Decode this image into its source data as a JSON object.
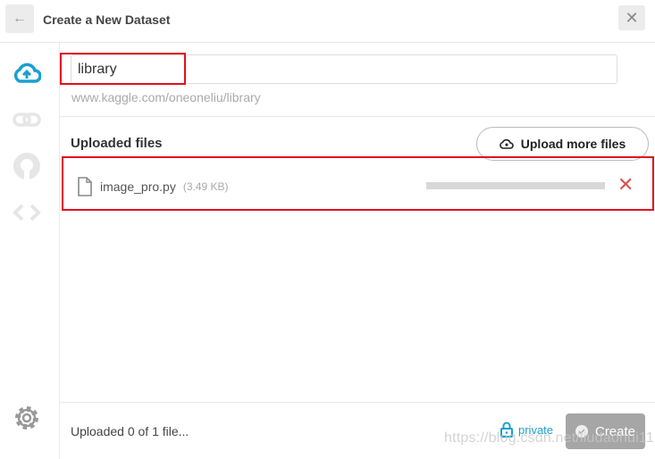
{
  "header": {
    "title": "Create a New Dataset",
    "back_icon": "arrow-left-icon",
    "close_icon": "close-icon"
  },
  "sidebar": {
    "items": [
      {
        "icon": "cloud-upload-icon",
        "active": true
      },
      {
        "icon": "link-icon"
      },
      {
        "icon": "github-icon"
      },
      {
        "icon": "code-icon"
      },
      {
        "icon": "gear-icon"
      }
    ]
  },
  "dataset": {
    "name": "library",
    "url": "www.kaggle.com/oneoneliu/library"
  },
  "files": {
    "heading": "Uploaded files",
    "upload_more_label": "Upload more files",
    "items": [
      {
        "name": "image_pro.py",
        "size": "(3.49 KB)",
        "progress": 0
      }
    ]
  },
  "footer": {
    "status": "Uploaded 0 of 1 file...",
    "visibility": "private",
    "create_label": "Create"
  },
  "watermark": "https://blog.csdn.net/liudaohui11",
  "colors": {
    "accent": "#1a9fd0",
    "highlight": "#e0101e",
    "remove": "#d9534f"
  }
}
